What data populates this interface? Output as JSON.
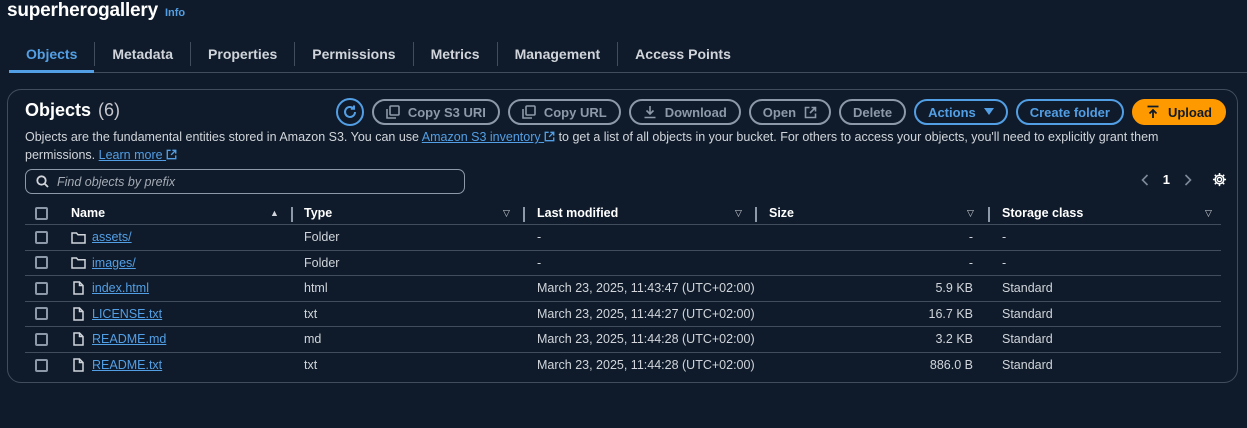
{
  "header": {
    "bucket_name": "superherogallery",
    "info": "Info"
  },
  "tabs": [
    {
      "label": "Objects",
      "active": true
    },
    {
      "label": "Metadata"
    },
    {
      "label": "Properties"
    },
    {
      "label": "Permissions"
    },
    {
      "label": "Metrics"
    },
    {
      "label": "Management"
    },
    {
      "label": "Access Points"
    }
  ],
  "panel": {
    "title": "Objects",
    "count": "(6)",
    "toolbar": {
      "copy_s3_uri": "Copy S3 URI",
      "copy_url": "Copy URL",
      "download": "Download",
      "open": "Open",
      "delete": "Delete",
      "actions": "Actions",
      "create_folder": "Create folder",
      "upload": "Upload"
    },
    "description": {
      "part1": "Objects are the fundamental entities stored in Amazon S3. You can use ",
      "inventory_link": "Amazon S3 inventory",
      "part2": " to get a list of all objects in your bucket. For others to access your objects, you'll need to explicitly grant them permissions. ",
      "learn_more": "Learn more"
    },
    "search": {
      "placeholder": "Find objects by prefix",
      "value": ""
    },
    "pagination": {
      "current_page": "1"
    }
  },
  "table": {
    "columns": {
      "name": "Name",
      "type": "Type",
      "last_modified": "Last modified",
      "size": "Size",
      "storage_class": "Storage class"
    },
    "rows": [
      {
        "name": "assets/",
        "icon": "folder-icon",
        "type": "Folder",
        "last_modified": "-",
        "size": "-",
        "storage_class": "-"
      },
      {
        "name": "images/",
        "icon": "folder-icon",
        "type": "Folder",
        "last_modified": "-",
        "size": "-",
        "storage_class": "-"
      },
      {
        "name": "index.html",
        "icon": "file-icon",
        "type": "html",
        "last_modified": "March 23, 2025, 11:43:47 (UTC+02:00)",
        "size": "5.9 KB",
        "storage_class": "Standard"
      },
      {
        "name": "LICENSE.txt",
        "icon": "file-icon",
        "type": "txt",
        "last_modified": "March 23, 2025, 11:44:27 (UTC+02:00)",
        "size": "16.7 KB",
        "storage_class": "Standard"
      },
      {
        "name": "README.md",
        "icon": "file-icon",
        "type": "md",
        "last_modified": "March 23, 2025, 11:44:28 (UTC+02:00)",
        "size": "3.2 KB",
        "storage_class": "Standard"
      },
      {
        "name": "README.txt",
        "icon": "file-icon",
        "type": "txt",
        "last_modified": "March 23, 2025, 11:44:28 (UTC+02:00)",
        "size": "886.0 B",
        "storage_class": "Standard"
      }
    ]
  },
  "colors": {
    "background": "#0f1b2a",
    "accent_blue": "#539fe5",
    "primary_orange": "#ff9900",
    "border": "#414d5c",
    "disabled": "#8d99a8"
  }
}
